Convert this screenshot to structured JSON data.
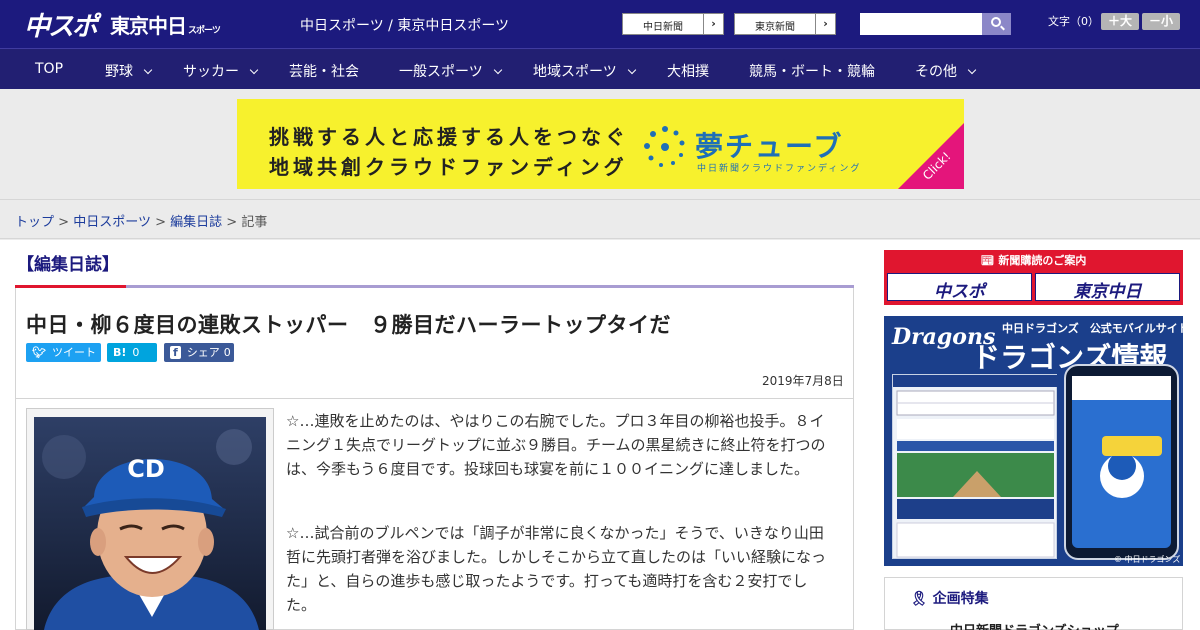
{
  "header": {
    "logo_chuspo": "中スポ",
    "logo_tokyo": "東京中日",
    "logo_tokyo_small": "スポーツ",
    "site_title": "中日スポーツ / 東京中日スポーツ",
    "ext_links": [
      "中日新聞",
      "東京新聞"
    ],
    "search_placeholder": "",
    "font_label": "文字（0）",
    "font_bigger": "＋大",
    "font_smaller": "－小"
  },
  "nav": {
    "items": [
      "TOP",
      "野球",
      "サッカー",
      "芸能・社会",
      "一般スポーツ",
      "地域スポーツ",
      "大相撲",
      "競馬・ボート・競輪",
      "その他"
    ]
  },
  "banner": {
    "line1": "挑戦する人と応援する人をつなぐ",
    "line2": "地域共創クラウドファンディング",
    "brand": "夢チューブ",
    "brand_sub": "中日新聞クラウドファンディング",
    "click": "Click!"
  },
  "breadcrumb": {
    "items": [
      "トップ",
      "中日スポーツ",
      "編集日誌"
    ],
    "separator": ">",
    "current": "記事"
  },
  "article": {
    "category": "【編集日誌】",
    "headline": "中日・柳６度目の連敗ストッパー　９勝目だハーラートップタイだ",
    "share": {
      "tweet": "ツイート",
      "hatena_icon": "B!",
      "hatena_count": "0",
      "fb_icon": "f",
      "fb_label": "シェア",
      "fb_count": "0"
    },
    "date": "2019年7月8日",
    "paragraphs": [
      "☆…連敗を止めたのは、やはりこの右腕でした。プロ３年目の柳裕也投手。８イニング１失点でリーグトップに並ぶ９勝目。チームの黒星続きに終止符を打つのは、今季もう６度目です。投球回も球宴を前に１００イニングに達しました。",
      "☆…試合前のブルペンでは「調子が非常に良くなかった」そうで、いきなり山田哲に先頭打者弾を浴びました。しかしそこから立て直したのは「いい経験になった」と、自らの進歩も感じ取ったようです。打っても適時打を含む２安打でした。"
    ]
  },
  "sidebar": {
    "subscribe_label": "新聞購読のご案内",
    "subscribe_logos": [
      "中スポ",
      "東京中日"
    ],
    "dragons_logo": "Dragons",
    "dragons_small": "中日ドラゴンズ　公式モバイルサイト",
    "dragons_big": "ドラゴンズ情報",
    "dragons_copy": "© 中日ドラゴンズ",
    "feature_title": "企画特集",
    "feature_item": "中日新聞ドラゴンズショップ"
  },
  "colors": {
    "header": "#1c1a7e",
    "nav": "#221f72",
    "banner_yellow": "#f7f12d",
    "accent_red": "#e0162f",
    "twitter": "#1da1f2",
    "hatena": "#00a4de",
    "facebook": "#3b5998"
  }
}
